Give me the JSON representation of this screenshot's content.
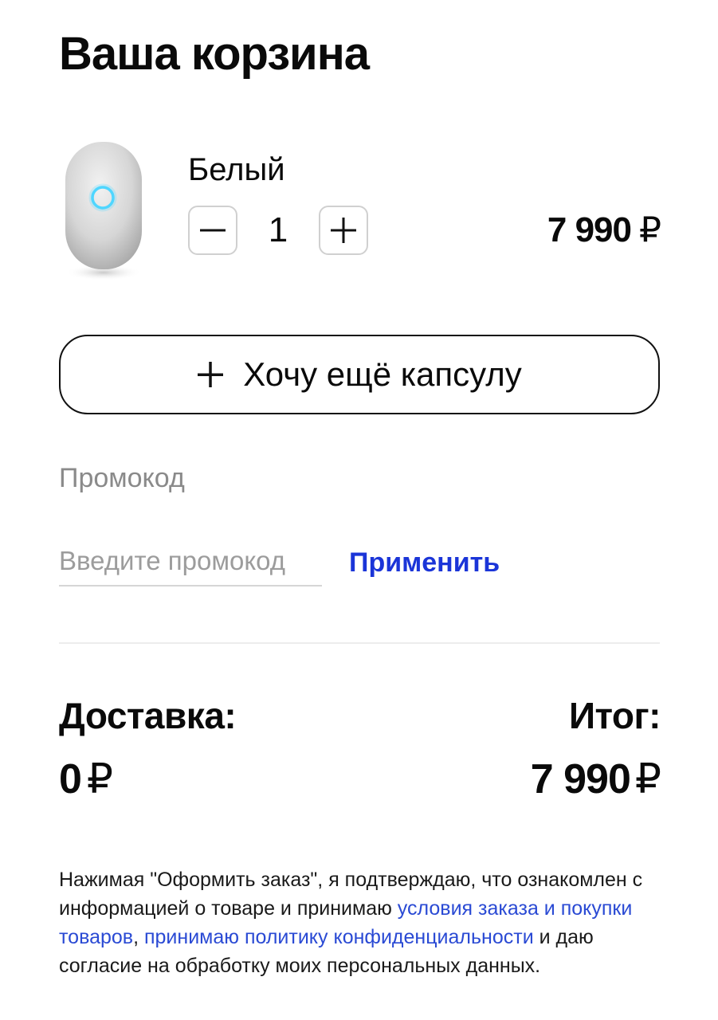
{
  "page": {
    "title": "Ваша корзина"
  },
  "cart_item": {
    "image_icon": "smart-speaker-white",
    "variant": "Белый",
    "quantity": "1",
    "price": "7 990",
    "currency": "₽",
    "minus_icon": "minus-icon",
    "plus_icon": "plus-icon"
  },
  "add_more": {
    "label": "Хочу ещё капсулу",
    "icon": "plus-icon"
  },
  "promo": {
    "heading": "Промокод",
    "placeholder": "Введите промокод",
    "value": "",
    "apply_label": "Применить"
  },
  "summary": {
    "delivery_label": "Доставка:",
    "delivery_value": "0",
    "total_label": "Итог:",
    "total_value": "7 990",
    "currency": "₽"
  },
  "legal": {
    "text_1": "Нажимая \"Оформить заказ\", я подтверждаю, что ознакомлен с информацией о товаре и принимаю ",
    "link_terms": "условия заказа и покупки товаров",
    "text_2": ", ",
    "link_privacy": "принимаю политику конфиденциальности",
    "text_3": " и даю согласие на обработку моих персональных данных."
  },
  "colors": {
    "link_accent": "#1b35d8",
    "muted_text": "#8a8a8a",
    "speaker_ring": "#4fd6ff"
  }
}
